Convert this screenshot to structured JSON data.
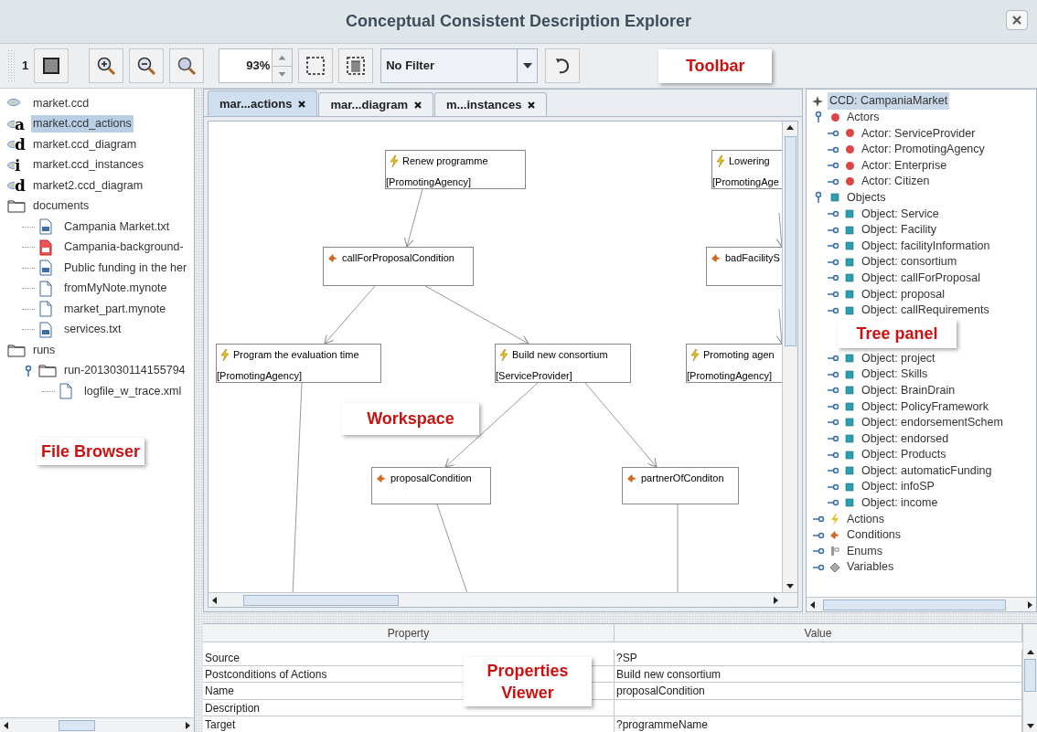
{
  "window": {
    "title": "Conceptual Consistent Description Explorer"
  },
  "toolbar": {
    "counter": "1",
    "zoom": "93%",
    "filter": "No Filter"
  },
  "callouts": {
    "toolbar": "Toolbar",
    "files": "File Browser",
    "workspace": "Workspace",
    "tree": "Tree panel",
    "properties": "Properties Viewer"
  },
  "file_browser": {
    "items": [
      {
        "label": "market.ccd",
        "kind": "ccd",
        "selected": false
      },
      {
        "label": "market.ccd_actions",
        "kind": "ccd",
        "letter": "a",
        "selected": true
      },
      {
        "label": "market.ccd_diagram",
        "kind": "ccd",
        "letter": "d",
        "selected": false
      },
      {
        "label": "market.ccd_instances",
        "kind": "ccd",
        "letter": "i",
        "selected": false
      },
      {
        "label": "market2.ccd_diagram",
        "kind": "ccd",
        "letter": "d",
        "selected": false
      },
      {
        "label": "documents",
        "kind": "folder",
        "selected": false,
        "children": [
          {
            "label": "Campania Market.txt",
            "kind": "txt",
            "selected": false
          },
          {
            "label": "Campania-background-",
            "kind": "pdf",
            "selected": false
          },
          {
            "label": "Public funding in the her",
            "kind": "txt",
            "selected": false
          },
          {
            "label": "fromMyNote.mynote",
            "kind": "note",
            "selected": false
          },
          {
            "label": "market_part.mynote",
            "kind": "note",
            "selected": false
          },
          {
            "label": "services.txt",
            "kind": "txt",
            "selected": false
          }
        ]
      },
      {
        "label": "runs",
        "kind": "folder",
        "selected": false,
        "children": [
          {
            "label": "run-2013030114155794",
            "kind": "folder",
            "expanded": true,
            "selected": false,
            "children": [
              {
                "label": "logfile_w_trace.xml",
                "kind": "note",
                "selected": false
              }
            ]
          }
        ]
      }
    ]
  },
  "tabs": [
    {
      "label": "mar...actions",
      "selected": true
    },
    {
      "label": "mar...diagram",
      "selected": false
    },
    {
      "label": "m...instances",
      "selected": false
    }
  ],
  "diagram": {
    "nodes": [
      {
        "kind": "action",
        "label": "Renew programme",
        "actor": "[PromotingAgency]"
      },
      {
        "kind": "action",
        "label": "Lowering",
        "actor": "[PromotingAge"
      },
      {
        "kind": "condition",
        "label": "callForProposalCondition"
      },
      {
        "kind": "condition",
        "label": "badFacilityS"
      },
      {
        "kind": "action",
        "label": "Program the evaluation time",
        "actor": "[PromotingAgency]"
      },
      {
        "kind": "action",
        "label": "Build new consortium",
        "actor": "[ServiceProvider]"
      },
      {
        "kind": "action",
        "label": "Promoting agen",
        "actor": "[PromotingAgency]"
      },
      {
        "kind": "condition",
        "label": "proposalCondition"
      },
      {
        "kind": "condition",
        "label": "partnerOfConditon"
      }
    ]
  },
  "tree": {
    "root": {
      "label": "CCD: CampaniaMarket",
      "kind": "root",
      "selected": true,
      "children": [
        {
          "label": "Actors",
          "kind": "actor",
          "expanded": true,
          "selected": false,
          "children": [
            {
              "label": "Actor: ServiceProvider",
              "kind": "actor",
              "expanded": false,
              "selected": false
            },
            {
              "label": "Actor: PromotingAgency",
              "kind": "actor",
              "expanded": false,
              "selected": false
            },
            {
              "label": "Actor: Enterprise",
              "kind": "actor",
              "expanded": false,
              "selected": false
            },
            {
              "label": "Actor: Citizen",
              "kind": "actor",
              "expanded": false,
              "selected": false
            }
          ]
        },
        {
          "label": "Objects",
          "kind": "object",
          "expanded": true,
          "selected": false,
          "children": [
            {
              "label": "Object: Service",
              "kind": "object",
              "expanded": false,
              "selected": false
            },
            {
              "label": "Object: Facility",
              "kind": "object",
              "expanded": false,
              "selected": false
            },
            {
              "label": "Object: facilityInformation",
              "kind": "object",
              "expanded": false,
              "selected": false
            },
            {
              "label": "Object: consortium",
              "kind": "object",
              "expanded": false,
              "selected": false
            },
            {
              "label": "Object: callForProposal",
              "kind": "object",
              "expanded": false,
              "selected": false
            },
            {
              "label": "Object: proposal",
              "kind": "object",
              "expanded": false,
              "selected": false
            },
            {
              "label": "Object: callRequirements",
              "kind": "object",
              "expanded": false,
              "selected": false
            },
            {
              "label": "Object: project",
              "kind": "object",
              "expanded": false,
              "selected": false
            },
            {
              "label": "Object: Skills",
              "kind": "object",
              "expanded": false,
              "selected": false
            },
            {
              "label": "Object: BrainDrain",
              "kind": "object",
              "expanded": false,
              "selected": false
            },
            {
              "label": "Object: PolicyFramework",
              "kind": "object",
              "expanded": false,
              "selected": false
            },
            {
              "label": "Object: endorsementSchem",
              "kind": "object",
              "expanded": false,
              "selected": false
            },
            {
              "label": "Object: endorsed",
              "kind": "object",
              "expanded": false,
              "selected": false
            },
            {
              "label": "Object: Products",
              "kind": "object",
              "expanded": false,
              "selected": false
            },
            {
              "label": "Object: automaticFunding",
              "kind": "object",
              "expanded": false,
              "selected": false
            },
            {
              "label": "Object: infoSP",
              "kind": "object",
              "expanded": false,
              "selected": false
            },
            {
              "label": "Object: income",
              "kind": "object",
              "expanded": false,
              "selected": false
            }
          ]
        },
        {
          "label": "Actions",
          "kind": "action",
          "expanded": false,
          "selected": false
        },
        {
          "label": "Conditions",
          "kind": "condition",
          "expanded": false,
          "selected": false
        },
        {
          "label": "Enums",
          "kind": "enum",
          "expanded": false,
          "selected": false
        },
        {
          "label": "Variables",
          "kind": "variable",
          "expanded": false,
          "selected": false
        }
      ]
    }
  },
  "properties": {
    "columns": [
      "Property",
      "Value"
    ],
    "rows": [
      [
        "Source",
        "?SP"
      ],
      [
        "Postconditions of Actions",
        "Build new consortium"
      ],
      [
        "Name",
        "proposalCondition"
      ],
      [
        "Description",
        ""
      ],
      [
        "Target",
        "?programmeName"
      ]
    ]
  }
}
